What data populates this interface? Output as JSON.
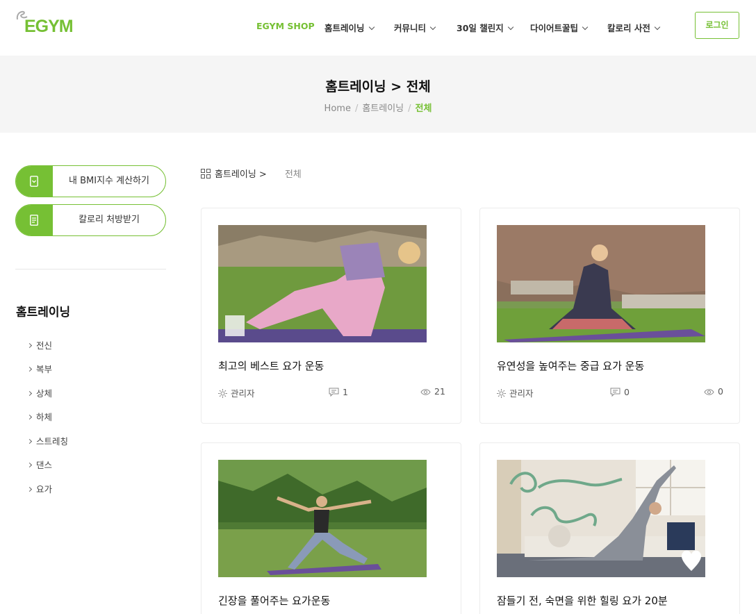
{
  "brand": {
    "name": "EGYM",
    "accent": "#76c034"
  },
  "nav": {
    "items": [
      "EGYM SHOP",
      "홈트레이닝",
      "커뮤니티",
      "30일 챌린지",
      "다이어트꿀팁",
      "칼로리 사전"
    ],
    "login": "로그인"
  },
  "banner": {
    "title": "홈트레이닝 > 전체",
    "crumbs": [
      "Home",
      "홈트레이닝",
      "전체"
    ]
  },
  "sidebar": {
    "bmi": "내 BMI지수 계산하기",
    "calorie": "칼로리 처방받기",
    "category_title": "홈트레이닝",
    "links": [
      "전신",
      "복부",
      "상체",
      "하체",
      "스트레칭",
      "댄스",
      "요가"
    ]
  },
  "content": {
    "path": "홈트레이닝 >",
    "current": "전체",
    "posts": [
      {
        "title": "최고의 베스트 요가 운동",
        "author": "관리자",
        "comments": "1",
        "views": "21"
      },
      {
        "title": "유연성을 높여주는 중급 요가 운동",
        "author": "관리자",
        "comments": "0",
        "views": "0"
      },
      {
        "title": "긴장을 풀어주는 요가운동",
        "author": "",
        "comments": "",
        "views": ""
      },
      {
        "title": "잠들기 전, 숙면을 위한 힐링 요가 20분",
        "author": "",
        "comments": "",
        "views": ""
      }
    ]
  }
}
